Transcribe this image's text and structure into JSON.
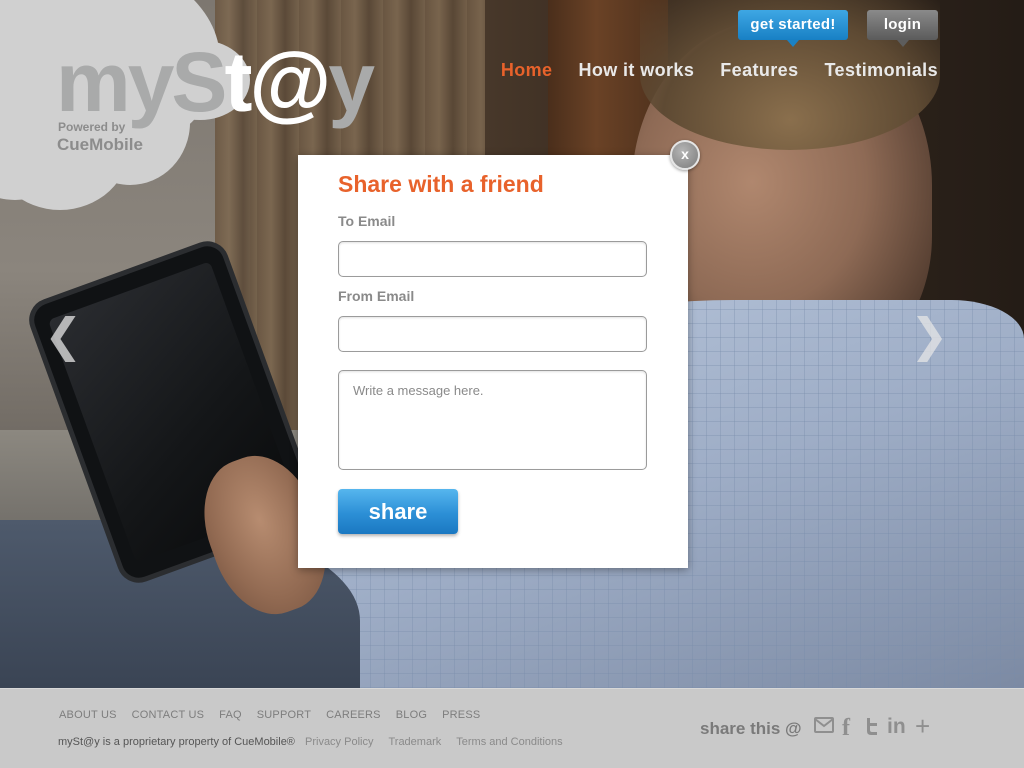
{
  "logo": {
    "brand_name_prefix": "myS",
    "brand_name_mid": "t",
    "brand_name_at": "@",
    "brand_name_suffix": "y",
    "powered_by": "Powered by",
    "brand_company": "CueMobile"
  },
  "header": {
    "get_started_label": "get started!",
    "login_label": "login",
    "nav": [
      {
        "label": "Home",
        "active": true
      },
      {
        "label": "How it works",
        "active": false
      },
      {
        "label": "Features",
        "active": false
      },
      {
        "label": "Testimonials",
        "active": false
      }
    ]
  },
  "carousel": {
    "prev_icon": "chevron-left-icon",
    "next_icon": "chevron-right-icon"
  },
  "modal": {
    "title": "Share with a friend",
    "to_email_label": "To Email",
    "to_email_value": "",
    "from_email_label": "From Email",
    "from_email_value": "",
    "message_placeholder": "Write a message here.",
    "share_label": "share",
    "close_label": "x"
  },
  "footer": {
    "links": [
      "ABOUT US",
      "CONTACT US",
      "FAQ",
      "SUPPORT",
      "CAREERS",
      "BLOG",
      "PRESS"
    ],
    "copyright": "mySt@y is a proprietary property of CueMobile®",
    "legal": [
      "Privacy Policy",
      "Trademark",
      "Terms and Conditions"
    ],
    "share_this": "share this @",
    "social_icons": [
      "email-icon",
      "facebook-icon",
      "twitter-icon",
      "linkedin-icon",
      "google-plus-icon"
    ]
  },
  "colors": {
    "accent": "#e8622b",
    "button_blue": "#2c8fd6",
    "footer_bg": "#c9c9c9"
  }
}
